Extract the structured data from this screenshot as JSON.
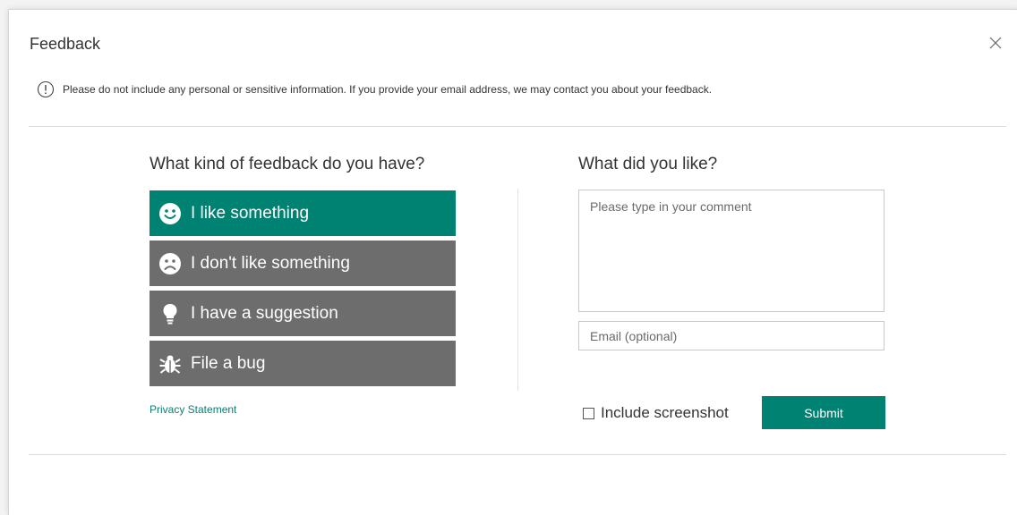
{
  "dialog": {
    "title": "Feedback",
    "notice": "Please do not include any personal or sensitive information. If you provide your email address, we may contact you about your feedback."
  },
  "left": {
    "heading": "What kind of feedback do you have?",
    "options": [
      {
        "label": "I like something",
        "icon": "smile-icon",
        "selected": true
      },
      {
        "label": "I don't like something",
        "icon": "frown-icon",
        "selected": false
      },
      {
        "label": "I have a suggestion",
        "icon": "lightbulb-icon",
        "selected": false
      },
      {
        "label": "File a bug",
        "icon": "bug-icon",
        "selected": false
      }
    ],
    "privacy_link": "Privacy Statement"
  },
  "right": {
    "heading": "What did you like?",
    "comment_placeholder": "Please type in your comment",
    "comment_value": "",
    "email_placeholder": "Email (optional)",
    "email_value": "",
    "include_screenshot_label": "Include screenshot",
    "include_screenshot_checked": false,
    "submit_label": "Submit"
  },
  "colors": {
    "accent": "#008272",
    "option_bg": "#6d6d6d",
    "link": "#107c6e"
  }
}
